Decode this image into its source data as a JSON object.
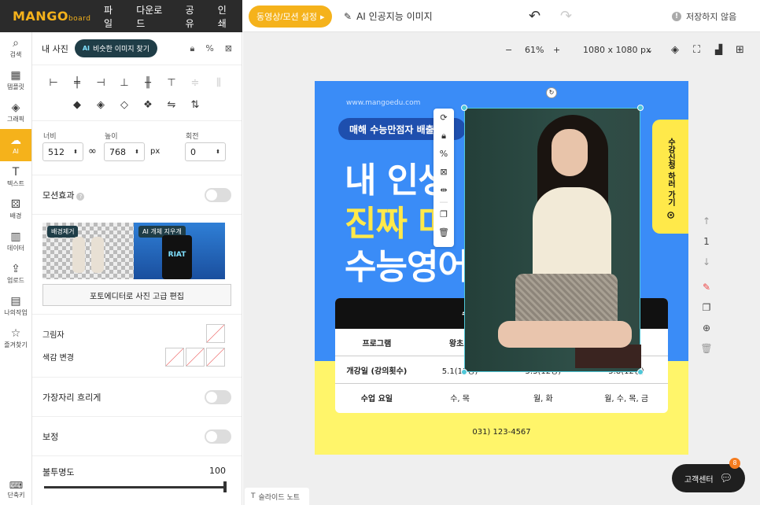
{
  "topbar": {
    "logo": "MANGO",
    "logo_sub": "board",
    "menu": [
      "파일",
      "다운로드",
      "공유",
      "인쇄"
    ],
    "motion_btn": "동영상/모션 설정",
    "ai_image": "AI 인공지능 이미지",
    "unsaved": "저장하지 않음"
  },
  "leftnav": [
    {
      "icon": "search-icon",
      "glyph": "⌕",
      "label": "검색"
    },
    {
      "icon": "template-icon",
      "glyph": "▦",
      "label": "템플릿"
    },
    {
      "icon": "graphic-icon",
      "glyph": "◈",
      "label": "그래픽"
    },
    {
      "icon": "ai-icon",
      "glyph": "☁",
      "label": "AI"
    },
    {
      "icon": "text-icon",
      "glyph": "T",
      "label": "텍스트"
    },
    {
      "icon": "background-icon",
      "glyph": "⚄",
      "label": "배경"
    },
    {
      "icon": "data-icon",
      "glyph": "▥",
      "label": "데이터"
    },
    {
      "icon": "upload-icon",
      "glyph": "⇪",
      "label": "업로드"
    },
    {
      "icon": "mywork-icon",
      "glyph": "▤",
      "label": "나의작업"
    },
    {
      "icon": "favorites-icon",
      "glyph": "☆",
      "label": "즐겨찾기"
    }
  ],
  "shortcut": "단축키",
  "panel": {
    "my_photo": "내 사진",
    "ai_find": "비슷한 이미지 찾기",
    "ai_badge": "AI",
    "width_label": "너비",
    "height_label": "높이",
    "rotate_label": "회전",
    "width": "512",
    "height": "768",
    "rotation": "0",
    "unit": "px",
    "motion": "모션효과",
    "thumb1_tag": "배경제거",
    "thumb2_tag": "AI 개체 지우개",
    "can_text": "RIAT",
    "photo_edit": "포토에디터로 사진 고급 편집",
    "shadow": "그림자",
    "color_change": "색감 변경",
    "edge_blur": "가장자리 흐리게",
    "correction": "보정",
    "opacity": "불투명도",
    "opacity_value": "100"
  },
  "zoombar": {
    "minus": "−",
    "zoom": "61%",
    "plus": "+",
    "size": "1080 x 1080 px"
  },
  "design": {
    "url": "www.mangoedu.com",
    "banner": "매해 수능만점자 배출 학원",
    "line1": "내 인생",
    "line2": "진짜 마",
    "line3": "수능영어",
    "side_btn": "수강신청 하러 가기",
    "table_title": "수능 영어의 새 역사",
    "col1": "프로그램",
    "col2": "왕초보",
    "row1_label": "개강일 (강의횟수)",
    "row1_v1": "5.1(12강)",
    "row1_v2": "5.3(12강)",
    "row1_v3": "5.8(12강)",
    "row2_label": "수업 요일",
    "row2_v1": "수, 목",
    "row2_v2": "월, 화",
    "row2_v3": "월, 수, 목, 금",
    "phone": "031) 123-4567"
  },
  "page_ctl": {
    "up": "↑",
    "page": "1",
    "down": "↓"
  },
  "notes": "슬라이드 노트",
  "support": "고객센터",
  "support_badge": "8"
}
